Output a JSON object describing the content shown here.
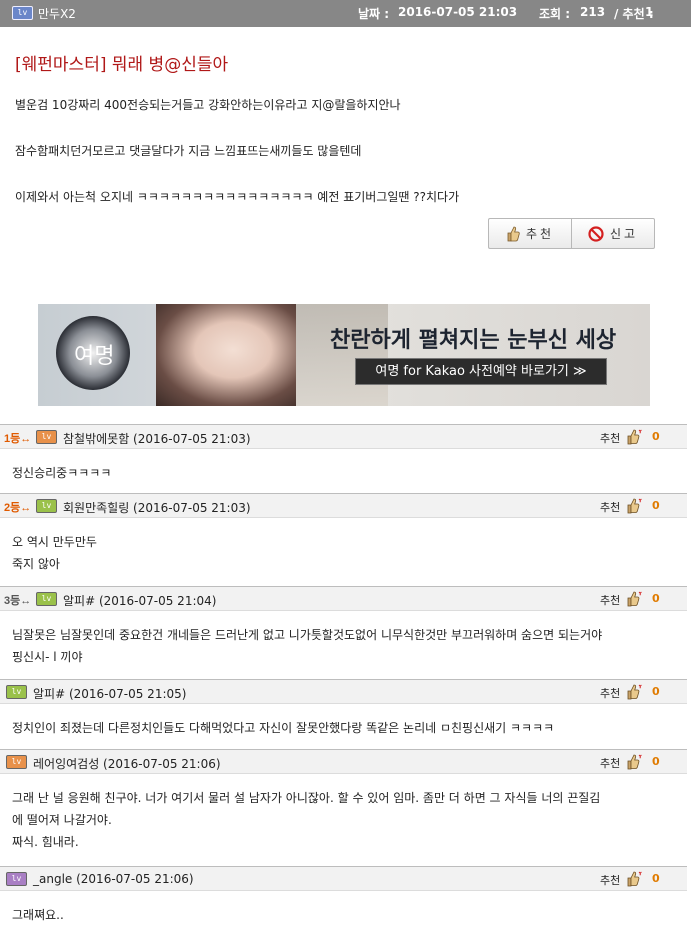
{
  "post": {
    "level_badge": "lv",
    "author": "만두X2",
    "date_label": "날짜 :",
    "date": "2016-07-05 21:03",
    "views_label": "조회 :",
    "views": "213",
    "rec_label": "/ 추천 :",
    "recommends": "1",
    "title": "[웨펀마스터] 뭐래 병@신들아",
    "body": [
      "별운검 10강짜리 400전승되는거들고 강화안하는이유라고 지@랄을하지안나",
      "잠수함패치던거모르고 댓글달다가 지금 느낌표뜨는새끼들도 많을텐데",
      "이제와서 아는척 오지네 ㅋㅋㅋㅋㅋㅋㅋㅋㅋㅋㅋㅋㅋㅋㅋㅋ 예전 표기버그일땐 ??치다가"
    ],
    "recommend_button": "추천",
    "report_button": "신고"
  },
  "banner": {
    "headline": "찬란하게 펼쳐지는 눈부신 세상",
    "cta": "여명 for Kakao 사전예약 바로가기 ≫",
    "emblem_text": "여명"
  },
  "comments": [
    {
      "rank": "1등↔",
      "rank_color": "#e05a00",
      "badge": "lv",
      "badge_color": "#e8914a",
      "author": "참철밖에못함 (2016-07-05 21:03)",
      "rec_label": "추천",
      "rec": "0",
      "lines": [
        "정신승리중ㅋㅋㅋㅋ"
      ]
    },
    {
      "rank": "2등↔",
      "rank_color": "#e05a00",
      "badge": "lv",
      "badge_color": "#9ac14a",
      "author": "회원만족힐링 (2016-07-05 21:03)",
      "rec_label": "추천",
      "rec": "0",
      "lines": [
        "오 역시 만두만두",
        "죽지 않아"
      ]
    },
    {
      "rank": "3등↔",
      "rank_color": "#555555",
      "badge": "lv",
      "badge_color": "#9ac14a",
      "author": "알피# (2016-07-05 21:04)",
      "rec_label": "추천",
      "rec": "0",
      "lines": [
        "님잘못은 님잘못인데 중요한건 개네들은 드러난게 없고 니가틋할것도없어 니무식한것만 부끄러워하며 숨으면 되는거야",
        "핑신시- l 끼야"
      ]
    },
    {
      "rank": "",
      "rank_color": "#555555",
      "badge": "lv",
      "badge_color": "#9ac14a",
      "author": "알피# (2016-07-05 21:05)",
      "rec_label": "추천",
      "rec": "0",
      "lines": [
        "정치인이 죄졌는데 다른정치인들도 다해먹었다고 자신이 잘못안했다랑 똑같은 논리네 ㅁ친핑신새기 ㅋㅋㅋㅋ"
      ]
    },
    {
      "rank": "",
      "rank_color": "#555555",
      "badge": "lv",
      "badge_color": "#e8914a",
      "author": "레어잉여검성 (2016-07-05 21:06)",
      "rec_label": "추천",
      "rec": "0",
      "lines": [
        "그래 난 널 응원해 친구야. 너가 여기서 물러 설 남자가 아니잖아. 할 수 있어 임마. 좀만 더 하면 그 자식들 너의 끈질김",
        "에 떨어져 나갈거야.",
        "짜식. 힘내라."
      ]
    },
    {
      "rank": "",
      "rank_color": "#555555",
      "badge": "lv",
      "badge_color": "#a97fc4",
      "author": "_angle (2016-07-05 21:06)",
      "rec_label": "추천",
      "rec": "0",
      "lines": [
        "그래쪄요.."
      ]
    }
  ],
  "colors": {
    "topbar": "#878787",
    "title": "#b01818",
    "recommend_count": "#e07b00"
  },
  "icons": {
    "recommend": "thumbs-up-icon",
    "report": "no-entry-icon"
  }
}
